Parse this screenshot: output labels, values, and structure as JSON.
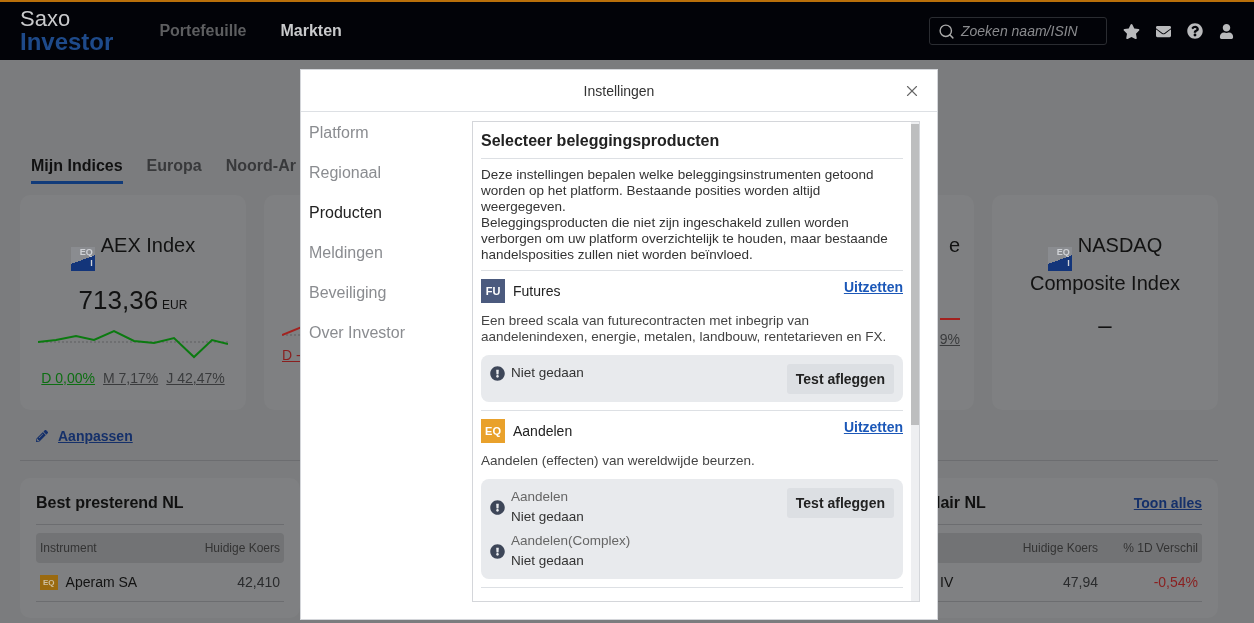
{
  "header": {
    "logo_top": "Saxo",
    "logo_bottom": "Investor",
    "nav": [
      {
        "label": "Portefeuille",
        "selected": false
      },
      {
        "label": "Markten",
        "selected": true
      }
    ],
    "search": {
      "placeholder": "Zoeken naam/ISIN"
    }
  },
  "tabs": [
    {
      "label": "Mijn Indices",
      "selected": true
    },
    {
      "label": "Europa",
      "selected": false
    },
    {
      "label": "Noord-Ar",
      "selected": false
    }
  ],
  "cards": [
    {
      "kind": "full",
      "icon_text": [
        "EQ",
        "I"
      ],
      "name": "AEX Index",
      "price": "713,36",
      "currency": "EUR",
      "sparkline": {
        "color": "#0b7a10"
      },
      "changes": [
        {
          "label": "D 0,00%",
          "color": "#0d6e12"
        },
        {
          "label": "M 7,17%",
          "color": "#3a3b3d"
        },
        {
          "label": "J 42,47%",
          "color": "#3a3b3d"
        }
      ]
    },
    {
      "kind": "clipped_left",
      "sparkline": {
        "color": "#a3221f"
      },
      "changes": [
        {
          "label": "D -",
          "color": "#8a1f1f"
        }
      ]
    },
    {
      "kind": "clipped_right",
      "name": "e",
      "sparkline": {
        "color": "#a3221f"
      },
      "changes": [
        {
          "label": "9%",
          "color": "#3a3b3d"
        }
      ]
    },
    {
      "kind": "full",
      "icon_text": [
        "EQ",
        "I"
      ],
      "name": "NASDAQ Composite Index",
      "price": "–"
    }
  ],
  "edit_link": "Aanpassen",
  "tables": [
    {
      "kind": "left",
      "title": "Best presterend NL",
      "columns": [
        "Instrument",
        "Huidige Koers"
      ],
      "rows": [
        {
          "cells": [
            {
              "badge": "EQ",
              "text": "Aperam SA",
              "color": "#121212"
            },
            {
              "text": "42,410",
              "color": "#2a2b2d"
            }
          ]
        }
      ]
    },
    {
      "kind": "right",
      "title": "lair NL",
      "link": "Toon alles",
      "columns": [
        "Huidige Koers",
        "% 1D Verschil"
      ],
      "rows": [
        {
          "name": "IV",
          "cells": [
            {
              "text": "47,94",
              "color": "#2a2b2d"
            },
            {
              "text": "-0,54%",
              "color": "#8a1f1f"
            }
          ]
        }
      ]
    }
  ],
  "modal": {
    "title": "Instellingen",
    "nav": [
      {
        "label": "Platform",
        "selected": false
      },
      {
        "label": "Regionaal",
        "selected": false
      },
      {
        "label": "Producten",
        "selected": true
      },
      {
        "label": "Meldingen",
        "selected": false
      },
      {
        "label": "Beveiliging",
        "selected": false
      },
      {
        "label": "Over Investor",
        "selected": false
      }
    ],
    "section_title": "Selecteer beleggingsproducten",
    "intro": [
      "Deze instellingen bepalen welke beleggingsinstrumenten getoond worden op het platform. Bestaande posities worden altijd weergegeven.",
      "Beleggingsproducten die niet zijn ingeschakeld zullen worden verborgen om uw platform overzichtelijk te houden, maar bestaande handelsposities zullen niet worden beïnvloed."
    ],
    "products": [
      {
        "code": "FU",
        "color": "#4b5a7e",
        "name": "Futures",
        "action": "Uitzetten",
        "description": "Een breed scala van futurecontracten met inbegrip van aandelenindexen, energie, metalen, landbouw, rentetarieven en FX.",
        "button": "Test afleggen",
        "tests": [
          {
            "status": "Niet gedaan"
          }
        ]
      },
      {
        "code": "EQ",
        "color": "#e9a12b",
        "name": "Aandelen",
        "action": "Uitzetten",
        "description": "Aandelen (effecten) van wereldwijde beurzen.",
        "button": "Test afleggen",
        "tests": [
          {
            "name": "Aandelen",
            "status": "Niet gedaan"
          },
          {
            "name": "Aandelen(Complex)",
            "status": "Niet gedaan"
          }
        ]
      }
    ]
  }
}
